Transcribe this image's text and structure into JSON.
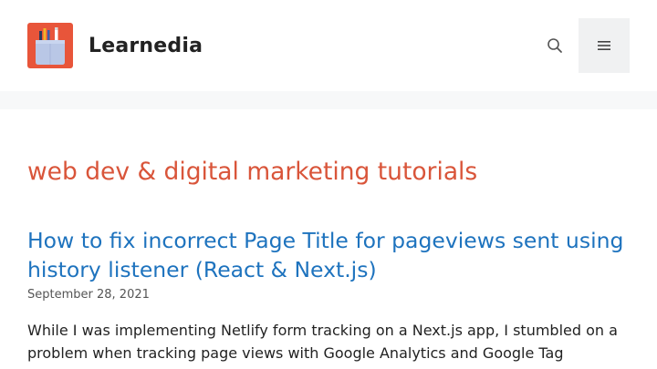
{
  "site": {
    "name": "Learnedia"
  },
  "header": {
    "search_icon": "search-icon",
    "menu_icon": "hamburger-menu-icon"
  },
  "archive": {
    "title": "web dev & digital marketing tutorials"
  },
  "posts": [
    {
      "title": "How to fix incorrect Page Title for pageviews sent using history listener (React & Next.js)",
      "date": "September 28, 2021",
      "excerpt": "While I was implementing Netlify form tracking on a Next.js app, I stumbled on a problem when tracking page views with Google Analytics and Google Tag"
    }
  ],
  "colors": {
    "accent": "#d9553a",
    "link": "#1e73be",
    "logo_bg": "#e8553a",
    "page_bg": "#f7f8f9"
  }
}
